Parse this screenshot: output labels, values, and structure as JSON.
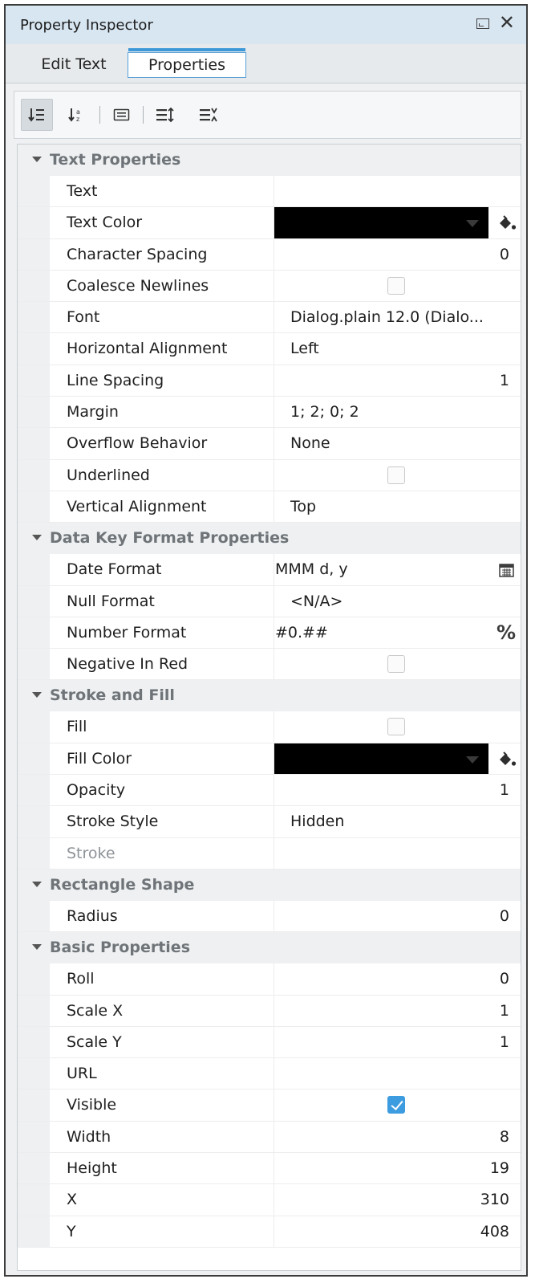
{
  "window": {
    "title": "Property Inspector"
  },
  "tabs": [
    {
      "label": "Edit Text"
    },
    {
      "label": "Properties"
    }
  ],
  "toolbar": {
    "buttons": [
      {
        "icon": "sort-category-icon",
        "active": true
      },
      {
        "icon": "sort-alphabetical-icon",
        "active": false
      },
      {
        "icon": "description-icon",
        "active": false
      },
      {
        "icon": "expand-all-icon",
        "active": false
      },
      {
        "icon": "collapse-all-icon",
        "active": false
      }
    ]
  },
  "colors": {
    "accent": "#3d98d8",
    "checkbox_on": "#3d9be0",
    "swatch_black": "#000000"
  },
  "groups": [
    {
      "title": "Text Properties",
      "rows": [
        {
          "name": "Text",
          "value": ""
        },
        {
          "name": "Text Color",
          "type": "color"
        },
        {
          "name": "Character Spacing",
          "value": "0",
          "align": "right"
        },
        {
          "name": "Coalesce Newlines",
          "type": "checkbox",
          "checked": false
        },
        {
          "name": "Font",
          "value": "Dialog.plain 12.0 (Dialo..."
        },
        {
          "name": "Horizontal Alignment",
          "value": "Left"
        },
        {
          "name": "Line Spacing",
          "value": "1",
          "align": "right"
        },
        {
          "name": "Margin",
          "value": "1; 2; 0; 2"
        },
        {
          "name": "Overflow Behavior",
          "value": "None"
        },
        {
          "name": "Underlined",
          "type": "checkbox",
          "checked": false
        },
        {
          "name": "Vertical Alignment",
          "value": "Top"
        }
      ]
    },
    {
      "title": "Data Key Format Properties",
      "rows": [
        {
          "name": "Date Format",
          "value": "MMM d, y",
          "align": "left0",
          "icon": "calendar-icon"
        },
        {
          "name": "Null Format",
          "value": "<N/A>"
        },
        {
          "name": "Number Format",
          "value": "#0.##",
          "align": "left0",
          "icon": "percent-icon"
        },
        {
          "name": "Negative In Red",
          "type": "checkbox",
          "checked": false
        }
      ]
    },
    {
      "title": "Stroke and Fill",
      "rows": [
        {
          "name": "Fill",
          "type": "checkbox",
          "checked": false
        },
        {
          "name": "Fill Color",
          "type": "color"
        },
        {
          "name": "Opacity",
          "value": "1",
          "align": "right"
        },
        {
          "name": "Stroke Style",
          "value": "Hidden"
        },
        {
          "name": "Stroke",
          "value": "",
          "disabled": true
        }
      ]
    },
    {
      "title": "Rectangle Shape",
      "rows": [
        {
          "name": "Radius",
          "value": "0",
          "align": "right"
        }
      ]
    },
    {
      "title": "Basic Properties",
      "rows": [
        {
          "name": "Roll",
          "value": "0",
          "align": "right"
        },
        {
          "name": "Scale X",
          "value": "1",
          "align": "right"
        },
        {
          "name": "Scale Y",
          "value": "1",
          "align": "right"
        },
        {
          "name": "URL",
          "value": ""
        },
        {
          "name": "Visible",
          "type": "checkbox",
          "checked": true
        },
        {
          "name": "Width",
          "value": "8",
          "align": "right"
        },
        {
          "name": "Height",
          "value": "19",
          "align": "right"
        },
        {
          "name": "X",
          "value": "310",
          "align": "right"
        },
        {
          "name": "Y",
          "value": "408",
          "align": "right"
        }
      ]
    }
  ]
}
